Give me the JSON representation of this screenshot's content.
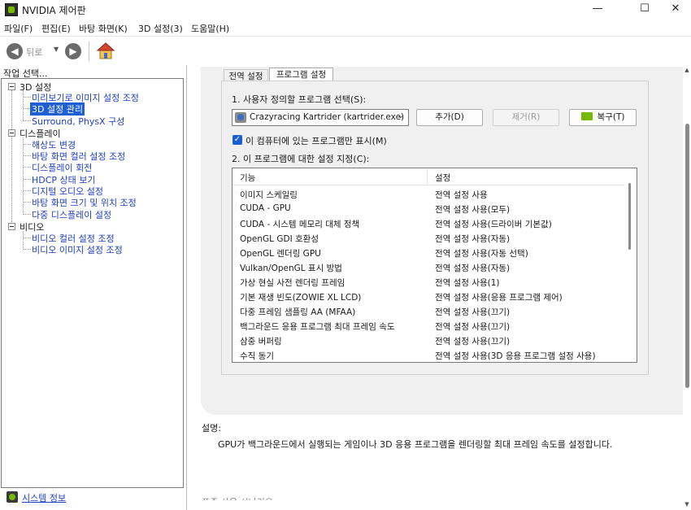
{
  "window": {
    "title": "NVIDIA 제어판",
    "minimize_glyph": "—",
    "maximize_glyph": "☐",
    "close_glyph": "✕"
  },
  "menu": [
    "파일(F)",
    "편집(E)",
    "바탕 화면(K)",
    "3D 설정(3)",
    "도움말(H)"
  ],
  "toolbar": {
    "back_label": "뒤로",
    "back_glyph": "◀",
    "forward_glyph": "▶",
    "dropdown_glyph": "▼"
  },
  "left_panel": {
    "header": "작업 선택...",
    "categories": [
      {
        "label": "3D 설정",
        "items": [
          "미리보기로 이미지 설정 조정",
          "3D 설정 관리",
          "Surround, PhysX 구성"
        ]
      },
      {
        "label": "디스플레이",
        "items": [
          "해상도 변경",
          "바탕 화면 컬러 설정 조정",
          "디스플레이 회전",
          "HDCP 상태 보기",
          "디지털 오디오 설정",
          "바탕 화면 크기 및 위치 조정",
          "다중 디스플레이 설정"
        ]
      },
      {
        "label": "비디오",
        "items": [
          "비디오 컬러 설정 조정",
          "비디오 이미지 설정 조정"
        ]
      }
    ],
    "selected_item": "3D 설정 관리",
    "system_info": "시스템 정보"
  },
  "tabs": [
    {
      "label": "전역 설정",
      "active": false
    },
    {
      "label": "프로그램 설정",
      "active": true
    }
  ],
  "program_settings": {
    "step1_label": "1. 사용자 정의할 프로그램 선택(S):",
    "selected_program": "Crazyracing Kartrider (kartrider.exe)",
    "caret_glyph": "⌄",
    "add_button": "추가(D)",
    "remove_button": "제거(R)",
    "restore_button": "복구(T)",
    "checkbox_label": "이 컴퓨터에 있는 프로그램만 표시(M)",
    "checkbox_checked": true,
    "step2_label": "2. 이 프로그램에 대한 설정 지정(C):",
    "columns": [
      "기능",
      "설정"
    ],
    "rows": [
      {
        "feature": "이미지 스케일링",
        "setting": "전역 설정 사용"
      },
      {
        "feature": "CUDA - GPU",
        "setting": "전역 설정 사용(모두)"
      },
      {
        "feature": "CUDA - 시스템 메모리 대체 정책",
        "setting": "전역 설정 사용(드라이버 기본값)"
      },
      {
        "feature": "OpenGL GDI 호환성",
        "setting": "전역 설정 사용(자동)"
      },
      {
        "feature": "OpenGL 렌더링 GPU",
        "setting": "전역 설정 사용(자동 선택)"
      },
      {
        "feature": "Vulkan/OpenGL 표시 방법",
        "setting": "전역 설정 사용(자동)"
      },
      {
        "feature": "가상 현실 사전 렌더링 프레임",
        "setting": "전역 설정 사용(1)"
      },
      {
        "feature": "기본 재생 빈도(ZOWIE XL LCD)",
        "setting": "전역 설정 사용(응용 프로그램 제어)"
      },
      {
        "feature": "다중 프레임 샘플링 AA (MFAA)",
        "setting": "전역 설정 사용(끄기)"
      },
      {
        "feature": "백그라운드 응용 프로그램 최대 프레임 속도",
        "setting": "전역 설정 사용(끄기)"
      },
      {
        "feature": "삼중 버퍼링",
        "setting": "전역 설정 사용(끄기)"
      },
      {
        "feature": "수직 동기",
        "setting": "전역 설정 사용(3D 응용 프로그램 설정 사용)"
      }
    ]
  },
  "description": {
    "title": "설명:",
    "text": "GPU가 백그라운드에서 실행되는 게임이나 3D 응용 프로그램을 렌더링할 최대 프레임 속도를 설정합니다.",
    "cut_off_text": "표준 사용 시나리오"
  },
  "colors": {
    "selection": "#1f5fd6",
    "link": "#1f3fbf",
    "nvidia_green": "#76b900",
    "panel_gray": "#f0f0f0"
  }
}
